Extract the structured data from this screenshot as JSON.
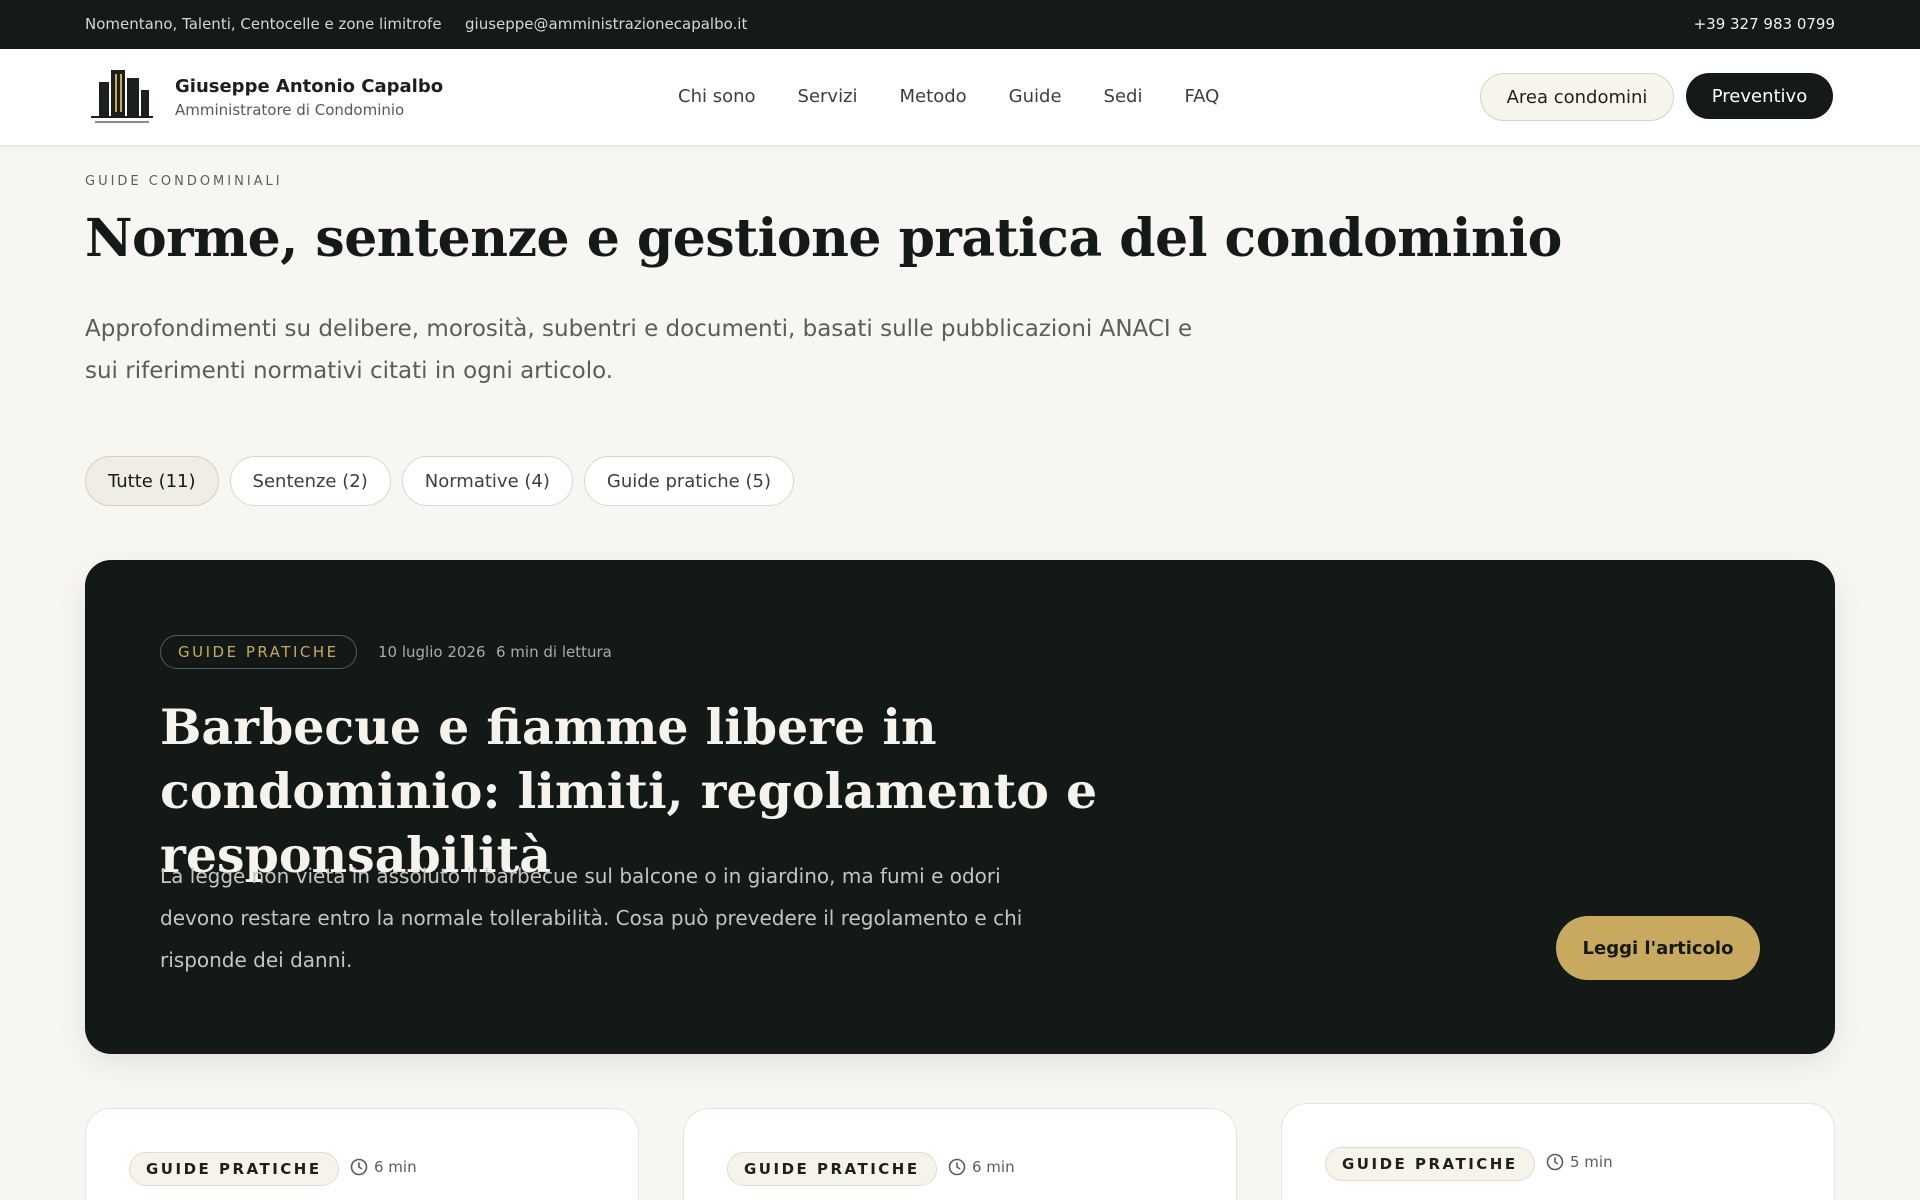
{
  "topbar": {
    "location": "Nomentano, Talenti, Centocelle e zone limitrofe",
    "email": "giuseppe@amministrazionecapalbo.it",
    "phone": "+39 327 983 0799"
  },
  "header": {
    "brand_name": "Giuseppe Antonio Capalbo",
    "brand_sub": "Amministratore di Condominio",
    "nav": [
      "Chi sono",
      "Servizi",
      "Metodo",
      "Guide",
      "Sedi",
      "FAQ"
    ],
    "area_button": "Area condomini",
    "quote_button": "Preventivo",
    "logo_icon": "building-logo"
  },
  "hero": {
    "eyebrow": "GUIDE CONDOMINIALI",
    "title": "Norme, sentenze e gestione pratica del condominio",
    "description": "Approfondimenti su delibere, morosità, subentri e documenti, basati sulle pubblicazioni ANACI e sui riferimenti normativi citati in ogni articolo."
  },
  "filters": [
    {
      "label": "Tutte (11)",
      "active": true
    },
    {
      "label": "Sentenze (2)",
      "active": false
    },
    {
      "label": "Normative (4)",
      "active": false
    },
    {
      "label": "Guide pratiche (5)",
      "active": false
    }
  ],
  "featured": {
    "category": "GUIDE PRATICHE",
    "date": "10 luglio 2026",
    "read_time": "6 min di lettura",
    "title": "Barbecue e fiamme libere in condominio: limiti, regolamento e responsabilità",
    "description": "La legge non vieta in assoluto il barbecue sul balcone o in giardino, ma fumi e odori devono restare entro la normale tollerabilità. Cosa può prevedere il regolamento e chi risponde dei danni.",
    "cta": "Leggi l'articolo"
  },
  "cards": [
    {
      "category": "GUIDE PRATICHE",
      "time": "6 min"
    },
    {
      "category": "GUIDE PRATICHE",
      "time": "6 min"
    },
    {
      "category": "GUIDE PRATICHE",
      "time": "5 min"
    }
  ],
  "colors": {
    "dark": "#141a18",
    "gold": "#c9a960",
    "background": "#f8f6f2"
  }
}
